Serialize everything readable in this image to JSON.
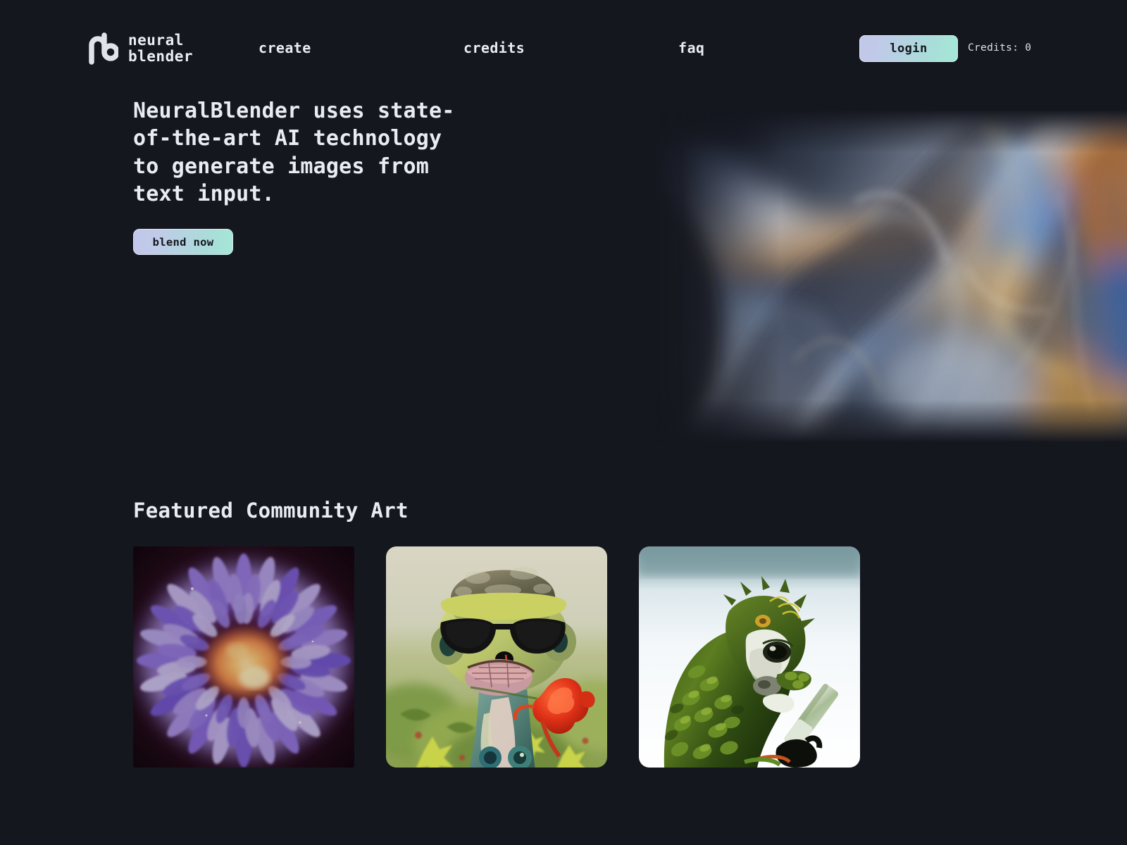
{
  "theme": {
    "background": "#15171f",
    "text": "#e9ecf2",
    "accent_gradient_start": "#c2c7e9",
    "accent_gradient_end": "#a4e8d8",
    "button_text": "#14161d"
  },
  "header": {
    "logo_icon": "nb-monogram-icon",
    "brand_name": "neural\nblender",
    "nav": [
      {
        "id": "create",
        "label": "create"
      },
      {
        "id": "credits",
        "label": "credits"
      },
      {
        "id": "faq",
        "label": "faq"
      }
    ],
    "login_label": "login",
    "credits_label": "Credits: 0"
  },
  "hero": {
    "headline": "NeuralBlender uses state-of-the-art AI technology to generate images from text input.",
    "cta_label": "blend now",
    "artwork_alt": "iridescent holographic liquid metal waves"
  },
  "featured": {
    "title": "Featured Community Art",
    "cards": [
      {
        "id": "card-1",
        "alt": "purple sea anemone with glowing orange center",
        "corner": "sharp"
      },
      {
        "id": "card-2",
        "alt": "surreal creature wearing sunglasses and bucket hat in a flower field",
        "corner": "round"
      },
      {
        "id": "card-3",
        "alt": "green moss-textured monkey on a pale blue background",
        "corner": "round"
      }
    ]
  }
}
